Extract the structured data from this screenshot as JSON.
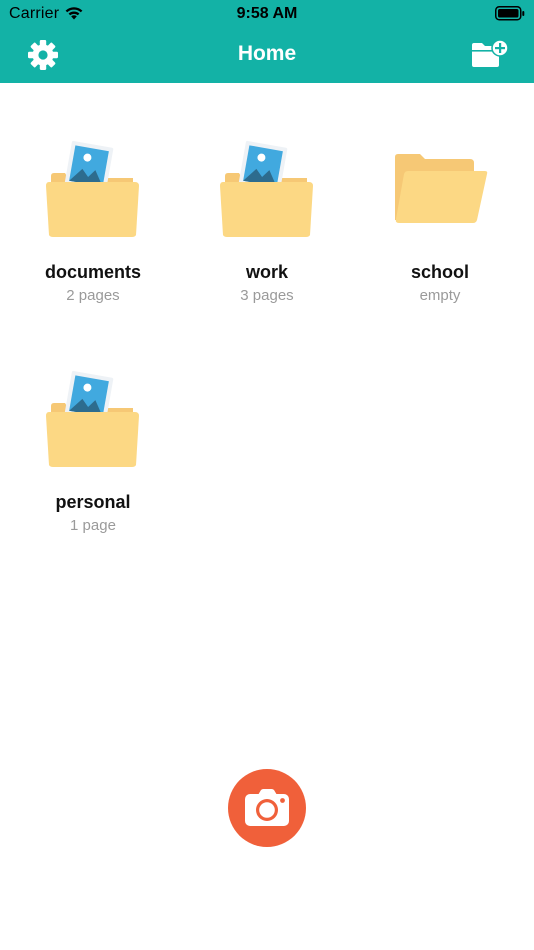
{
  "status_bar": {
    "carrier": "Carrier",
    "time": "9:58 AM",
    "icons": [
      "wifi-icon",
      "battery-icon"
    ]
  },
  "header": {
    "title": "Home",
    "background": "#13b2a6",
    "left_icon": "gear-icon",
    "right_icon": "new-folder-icon"
  },
  "folders": [
    {
      "name": "documents",
      "count": "2 pages",
      "icon": "folder-with-photo-icon"
    },
    {
      "name": "work",
      "count": "3 pages",
      "icon": "folder-with-photo-icon"
    },
    {
      "name": "school",
      "count": "empty",
      "icon": "open-folder-icon"
    },
    {
      "name": "personal",
      "count": "1 page",
      "icon": "folder-with-photo-icon"
    }
  ],
  "camera_button": {
    "icon": "camera-icon",
    "color": "#f0603a"
  },
  "colors": {
    "folder_body": "#fcd884",
    "folder_tab": "#f6c875",
    "photo_blue": "#41a9df"
  }
}
